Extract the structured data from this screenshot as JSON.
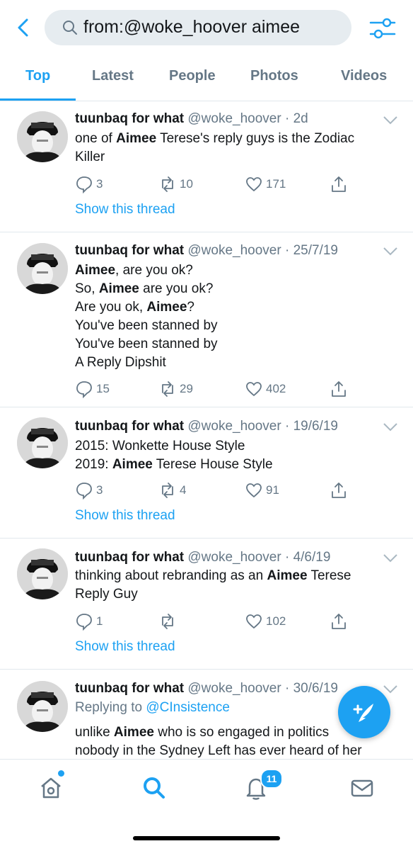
{
  "search": {
    "query": "from:@woke_hoover aimee"
  },
  "tabs": [
    {
      "label": "Top"
    },
    {
      "label": "Latest"
    },
    {
      "label": "People"
    },
    {
      "label": "Photos"
    },
    {
      "label": "Videos"
    }
  ],
  "tweets": [
    {
      "name": "tuunbaq for what",
      "meta": "@woke_hoover · 2d",
      "lines": [
        [
          {
            "t": "one of "
          },
          {
            "t": "Aimee",
            "b": true
          },
          {
            "t": " Terese's reply guys is the Zodiac"
          }
        ],
        [
          {
            "t": "Killer"
          }
        ]
      ],
      "replies": "3",
      "retweets": "10",
      "likes": "171",
      "show_thread": "Show this thread"
    },
    {
      "name": "tuunbaq for what",
      "meta": "@woke_hoover · 25/7/19",
      "lines": [
        [
          {
            "t": "Aimee",
            "b": true
          },
          {
            "t": ", are you ok?"
          }
        ],
        [
          {
            "t": "So, "
          },
          {
            "t": "Aimee",
            "b": true
          },
          {
            "t": " are you ok?"
          }
        ],
        [
          {
            "t": "Are you ok, "
          },
          {
            "t": "Aimee",
            "b": true
          },
          {
            "t": "?"
          }
        ],
        [
          {
            "t": "You've been stanned by"
          }
        ],
        [
          {
            "t": "You've been stanned by"
          }
        ],
        [
          {
            "t": "A Reply Dipshit"
          }
        ]
      ],
      "replies": "15",
      "retweets": "29",
      "likes": "402"
    },
    {
      "name": "tuunbaq for what",
      "meta": "@woke_hoover · 19/6/19",
      "lines": [
        [
          {
            "t": "2015: Wonkette House Style"
          }
        ],
        [
          {
            "t": "2019: "
          },
          {
            "t": "Aimee",
            "b": true
          },
          {
            "t": " Terese House Style"
          }
        ]
      ],
      "replies": "3",
      "retweets": "4",
      "likes": "91",
      "show_thread": "Show this thread"
    },
    {
      "name": "tuunbaq for what",
      "meta": "@woke_hoover · 4/6/19",
      "lines": [
        [
          {
            "t": "thinking about rebranding as an "
          },
          {
            "t": "Aimee",
            "b": true
          },
          {
            "t": " Terese"
          }
        ],
        [
          {
            "t": "Reply Guy"
          }
        ]
      ],
      "replies": "1",
      "retweets": "",
      "likes": "102",
      "show_thread": "Show this thread"
    },
    {
      "name": "tuunbaq for what",
      "meta": "@woke_hoover · 30/6/19",
      "replying_prefix": "Replying to ",
      "replying_handle": "@CInsistence",
      "lines": [
        [
          {
            "t": "unlike "
          },
          {
            "t": "Aimee",
            "b": true
          },
          {
            "t": " who is so engaged in politics"
          }
        ],
        [
          {
            "t": "nobody in the Sydney Left has ever heard of her"
          }
        ]
      ]
    }
  ],
  "nav": {
    "notifications_badge": "11"
  },
  "colors": {
    "accent": "#1da1f2",
    "secondary_text": "#657786",
    "divider": "#e1e8ed"
  }
}
